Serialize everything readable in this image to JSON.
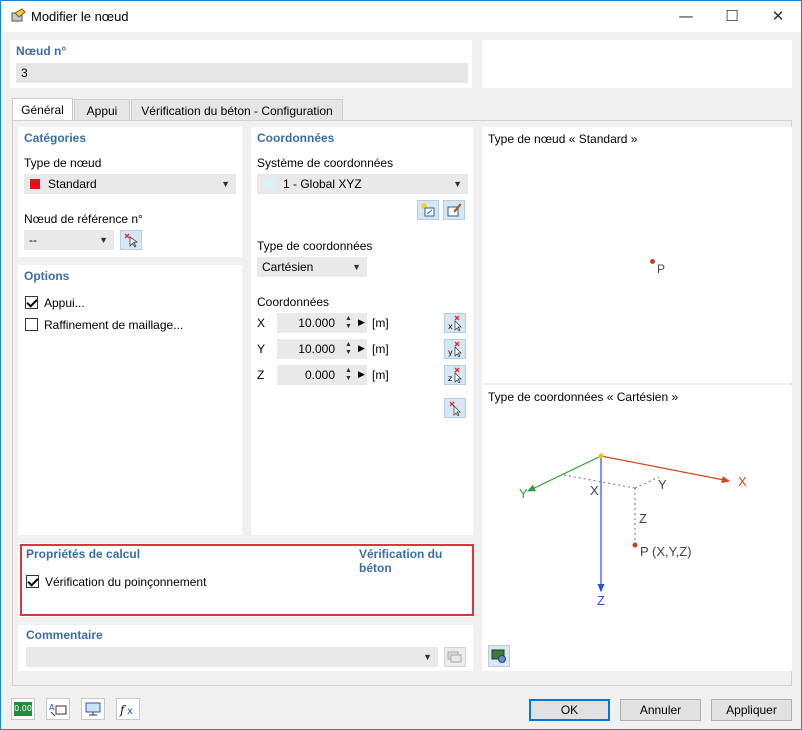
{
  "window": {
    "title": "Modifier le nœud",
    "controls": {
      "minimize": "—",
      "maximize": "☐",
      "close": "✕"
    }
  },
  "header": {
    "node_label": "Nœud n°",
    "node_value": "3"
  },
  "tabs": [
    {
      "label": "Général",
      "active": true
    },
    {
      "label": "Appui",
      "active": false
    },
    {
      "label": "Vérification du béton - Configuration",
      "active": false
    }
  ],
  "categories": {
    "title": "Catégories",
    "node_type_label": "Type de nœud",
    "node_type_value": "Standard",
    "node_type_color": "#e0131b",
    "reference_label": "Nœud de référence n°",
    "reference_value": "--"
  },
  "options": {
    "title": "Options",
    "items": [
      {
        "label": "Appui...",
        "checked": true
      },
      {
        "label": "Raffinement de maillage...",
        "checked": false
      }
    ]
  },
  "coordinates": {
    "title": "Coordonnées",
    "system_label": "Système de coordonnées",
    "system_value": "1 - Global XYZ",
    "type_label": "Type de coordonnées",
    "type_value": "Cartésien",
    "coords_label": "Coordonnées",
    "rows": [
      {
        "axis": "X",
        "value": "10.000",
        "unit": "[m]"
      },
      {
        "axis": "Y",
        "value": "10.000",
        "unit": "[m]"
      },
      {
        "axis": "Z",
        "value": "0.000",
        "unit": "[m]"
      }
    ]
  },
  "calc_props": {
    "title": "Propriétés de calcul",
    "link": "Vérification du béton",
    "punching_label": "Vérification du poinçonnement",
    "punching_checked": true
  },
  "comment": {
    "title": "Commentaire",
    "value": ""
  },
  "preview": {
    "node_type_title": "Type de nœud « Standard »",
    "node_point_label": "P",
    "coord_type_title": "Type de coordonnées « Cartésien »",
    "axis_x": "X",
    "axis_y": "Y",
    "axis_z": "Z",
    "point_label": "P (X,Y,Z)",
    "colors": {
      "x_axis": "#d9431e",
      "y_axis": "#2e9e3a",
      "z_axis": "#2a50c8",
      "point": "#b5472a",
      "origin": "#e6c21a"
    }
  },
  "footer": {
    "ok": "OK",
    "cancel": "Annuler",
    "apply": "Appliquer",
    "tool_icons": [
      "decimal-places-icon",
      "node-numbering-icon",
      "display-settings-icon",
      "formula-icon"
    ],
    "decimal_text": "0.00"
  }
}
